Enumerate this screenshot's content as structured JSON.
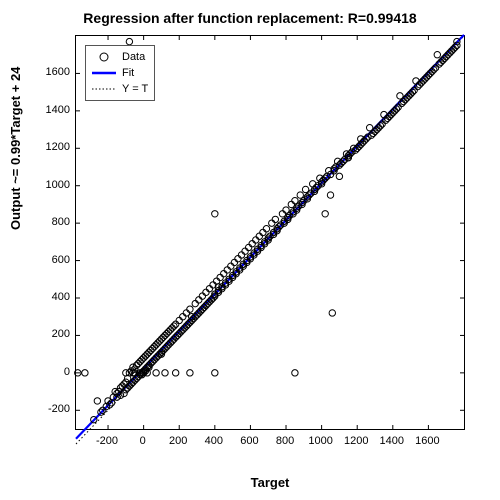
{
  "chart_data": {
    "type": "scatter",
    "title": "Regression after function replacement: R=0.99418",
    "xlabel": "Target",
    "ylabel": "Output ~= 0.99*Target + 24",
    "xlim": [
      -380,
      1800
    ],
    "ylim": [
      -300,
      1800
    ],
    "xticks": [
      -200,
      0,
      200,
      400,
      600,
      800,
      1000,
      1200,
      1400,
      1600
    ],
    "yticks": [
      -200,
      0,
      200,
      400,
      600,
      800,
      1000,
      1200,
      1400,
      1600
    ],
    "legend": {
      "position": "upper-left",
      "entries": [
        "Data",
        "Fit",
        "Y = T"
      ]
    },
    "series": [
      {
        "name": "Data",
        "type": "scatter",
        "marker": "open-circle",
        "color": "#000000",
        "x": [
          -370,
          -330,
          -280,
          -260,
          -240,
          -230,
          -210,
          -200,
          -190,
          -180,
          -170,
          -160,
          -150,
          -150,
          -140,
          -130,
          -130,
          -120,
          -110,
          -110,
          -100,
          -100,
          -100,
          -90,
          -90,
          -80,
          -80,
          -70,
          -70,
          -60,
          -60,
          -60,
          -50,
          -50,
          -40,
          -40,
          -30,
          -30,
          -20,
          -20,
          -10,
          -10,
          -10,
          0,
          0,
          0,
          10,
          10,
          10,
          20,
          20,
          30,
          30,
          30,
          40,
          40,
          50,
          50,
          60,
          60,
          70,
          70,
          80,
          80,
          90,
          90,
          100,
          100,
          100,
          110,
          110,
          120,
          120,
          130,
          130,
          140,
          140,
          150,
          150,
          160,
          160,
          170,
          170,
          180,
          180,
          190,
          200,
          200,
          210,
          220,
          220,
          230,
          240,
          240,
          250,
          260,
          260,
          270,
          270,
          280,
          290,
          290,
          300,
          310,
          310,
          320,
          330,
          330,
          340,
          350,
          350,
          360,
          370,
          370,
          380,
          390,
          390,
          400,
          400,
          400,
          410,
          420,
          420,
          430,
          440,
          440,
          450,
          460,
          460,
          470,
          480,
          480,
          490,
          500,
          500,
          510,
          520,
          520,
          530,
          540,
          540,
          550,
          560,
          560,
          570,
          580,
          580,
          590,
          600,
          600,
          610,
          620,
          620,
          630,
          640,
          640,
          650,
          660,
          660,
          670,
          680,
          680,
          690,
          700,
          700,
          710,
          720,
          730,
          730,
          740,
          750,
          750,
          760,
          770,
          780,
          790,
          790,
          800,
          810,
          810,
          820,
          830,
          840,
          840,
          850,
          860,
          860,
          870,
          880,
          890,
          890,
          900,
          910,
          920,
          920,
          930,
          940,
          950,
          960,
          960,
          970,
          980,
          990,
          1000,
          1000,
          1010,
          1020,
          1030,
          1040,
          1050,
          1060,
          1070,
          1070,
          1080,
          1090,
          1100,
          1110,
          1120,
          1130,
          1140,
          1150,
          1150,
          1160,
          1170,
          1180,
          1190,
          1200,
          1210,
          1220,
          1220,
          1230,
          1240,
          1250,
          1260,
          1270,
          1280,
          1290,
          1300,
          1310,
          1320,
          1330,
          1340,
          1350,
          1360,
          1370,
          1380,
          1390,
          1400,
          1410,
          1420,
          1430,
          1440,
          1450,
          1460,
          1470,
          1480,
          1490,
          1500,
          1510,
          1520,
          1530,
          1540,
          1550,
          1560,
          1570,
          1580,
          1590,
          1600,
          1610,
          1620,
          1630,
          1640,
          1650,
          1660,
          1670,
          1680,
          1690,
          1700,
          1710,
          1720,
          1730,
          1740,
          1750,
          1760,
          1760,
          -80,
          -50,
          -20,
          20,
          70,
          120,
          180,
          260,
          400,
          850,
          420,
          1020,
          1050,
          1150,
          1100
        ],
        "y": [
          0,
          0,
          -250,
          -150,
          -210,
          -200,
          -180,
          -150,
          -170,
          -160,
          -130,
          -100,
          -130,
          -110,
          -100,
          -80,
          -120,
          -70,
          -110,
          -60,
          -90,
          -50,
          0,
          -80,
          -30,
          -70,
          0,
          -60,
          10,
          -50,
          0,
          30,
          -40,
          20,
          -30,
          40,
          -20,
          50,
          -10,
          60,
          0,
          70,
          -10,
          10,
          80,
          0,
          20,
          90,
          10,
          30,
          100,
          40,
          110,
          30,
          50,
          120,
          60,
          130,
          70,
          140,
          80,
          150,
          90,
          160,
          100,
          170,
          110,
          180,
          100,
          120,
          190,
          130,
          200,
          140,
          210,
          150,
          220,
          160,
          230,
          170,
          240,
          180,
          250,
          190,
          260,
          200,
          210,
          280,
          220,
          230,
          300,
          240,
          250,
          320,
          260,
          270,
          340,
          280,
          300,
          290,
          300,
          370,
          310,
          320,
          390,
          330,
          340,
          410,
          350,
          360,
          430,
          370,
          380,
          450,
          390,
          400,
          470,
          410,
          420,
          850,
          490,
          430,
          440,
          510,
          450,
          460,
          530,
          470,
          480,
          550,
          490,
          500,
          570,
          510,
          520,
          590,
          530,
          540,
          610,
          550,
          560,
          630,
          570,
          580,
          650,
          590,
          600,
          670,
          610,
          620,
          690,
          630,
          640,
          710,
          650,
          660,
          730,
          670,
          680,
          750,
          690,
          700,
          770,
          710,
          720,
          730,
          800,
          740,
          750,
          820,
          760,
          770,
          780,
          790,
          850,
          800,
          810,
          870,
          820,
          830,
          840,
          900,
          850,
          860,
          920,
          870,
          880,
          890,
          950,
          900,
          910,
          920,
          980,
          930,
          940,
          950,
          960,
          1010,
          970,
          980,
          990,
          1000,
          1040,
          1010,
          1020,
          1030,
          1040,
          1050,
          1080,
          1060,
          320,
          1080,
          1090,
          1100,
          1130,
          1110,
          1120,
          1130,
          1140,
          1170,
          1150,
          1160,
          1170,
          1180,
          1200,
          1190,
          1200,
          1210,
          1250,
          1220,
          1230,
          1240,
          1250,
          1260,
          1310,
          1270,
          1280,
          1290,
          1300,
          1310,
          1320,
          1330,
          1380,
          1350,
          1360,
          1370,
          1380,
          1390,
          1400,
          1410,
          1420,
          1480,
          1440,
          1450,
          1460,
          1470,
          1480,
          1490,
          1500,
          1510,
          1560,
          1530,
          1540,
          1550,
          1560,
          1570,
          1580,
          1590,
          1600,
          1610,
          1620,
          1630,
          1700,
          1650,
          1660,
          1670,
          1680,
          1690,
          1700,
          1710,
          1720,
          1730,
          1740,
          1750,
          1770,
          1770,
          0,
          0,
          0,
          0,
          0,
          0,
          0,
          0,
          0,
          460,
          850,
          950,
          1150,
          1050,
          1200
        ]
      },
      {
        "name": "Fit",
        "type": "line",
        "color": "#0000ff",
        "linewidth": 2,
        "formula": "y = 0.99*x + 24",
        "x": [
          -380,
          1800
        ],
        "y": [
          -352,
          1806
        ]
      },
      {
        "name": "Y = T",
        "type": "line",
        "color": "#000000",
        "style": "dotted",
        "formula": "y = x",
        "x": [
          -380,
          1800
        ],
        "y": [
          -380,
          1800
        ]
      }
    ]
  }
}
